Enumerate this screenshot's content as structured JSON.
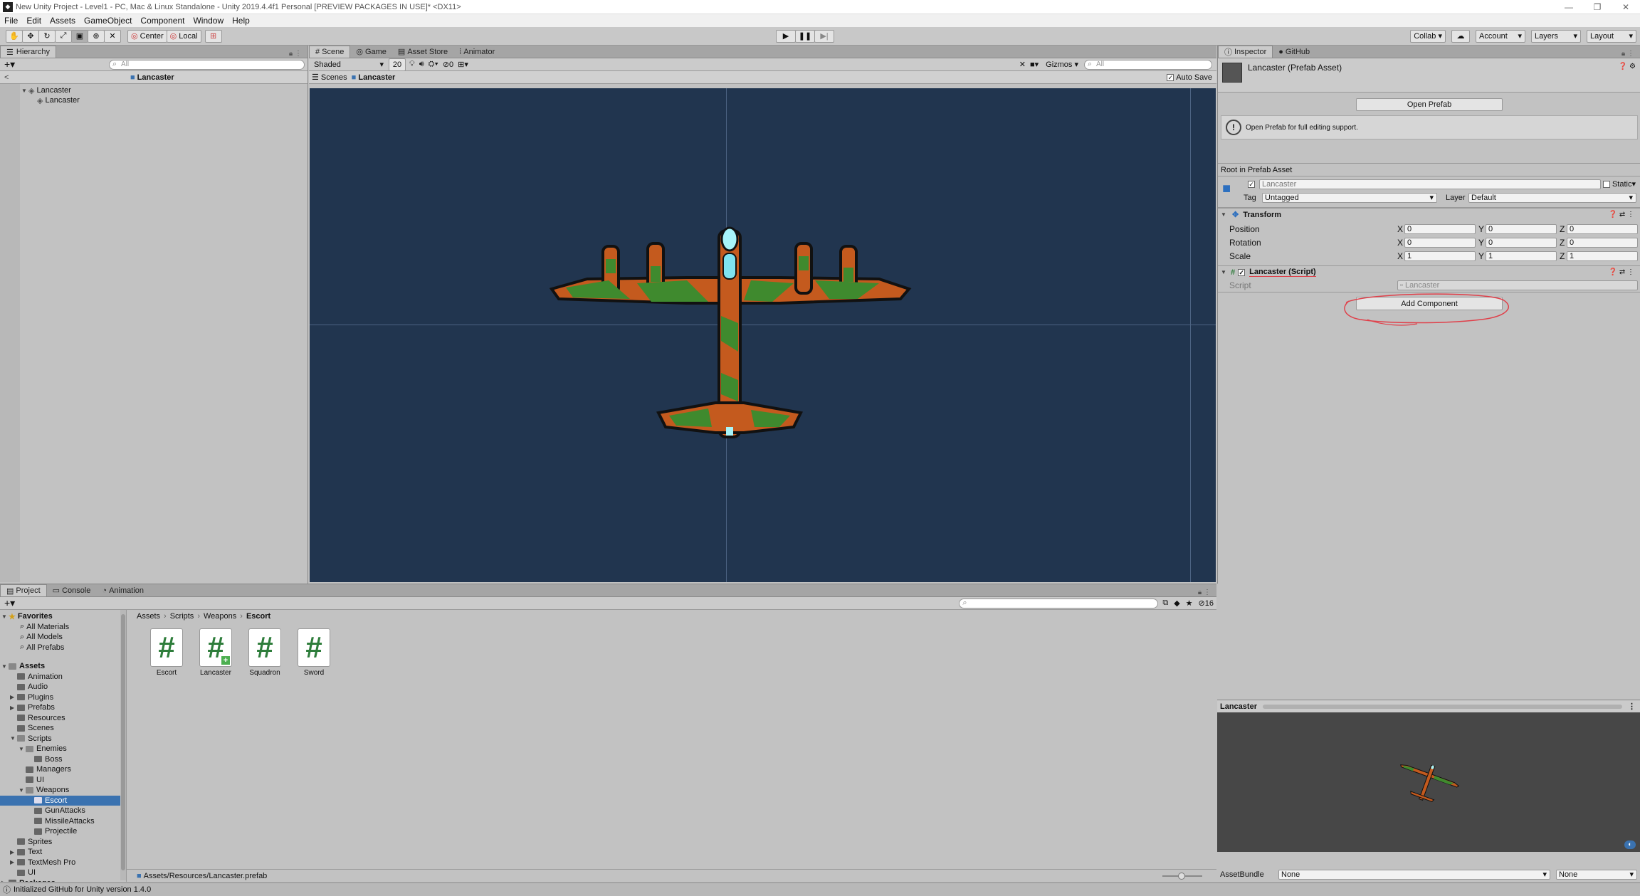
{
  "window": {
    "title": "New Unity Project - Level1 - PC, Mac & Linux Standalone - Unity 2019.4.4f1 Personal [PREVIEW PACKAGES IN USE]* <DX11>",
    "minimize": "—",
    "maximize": "❐",
    "close": "✕"
  },
  "menu": [
    "File",
    "Edit",
    "Assets",
    "GameObject",
    "Component",
    "Window",
    "Help"
  ],
  "toolbar": {
    "center": "Center",
    "local": "Local",
    "collab": "Collab",
    "account": "Account",
    "layers": "Layers",
    "layout": "Layout"
  },
  "hierarchy": {
    "tab": "Hierarchy",
    "search_placeholder": "All",
    "breadcrumb": "Lancaster",
    "items": [
      "Lancaster",
      "Lancaster"
    ]
  },
  "scene_tabs": [
    "Scene",
    "Game",
    "Asset Store",
    "Animator"
  ],
  "scene": {
    "shading": "Shaded",
    "dim": "20",
    "fx_count": "0",
    "gizmos": "Gizmos",
    "search_placeholder": "All",
    "breadcrumb_root": "Scenes",
    "breadcrumb_item": "Lancaster",
    "autosave": "Auto Save"
  },
  "inspector": {
    "tabs": [
      "Inspector",
      "GitHub"
    ],
    "title": "Lancaster (Prefab Asset)",
    "open_prefab": "Open Prefab",
    "info": "Open Prefab for full editing support.",
    "root": "Root in Prefab Asset",
    "name": "Lancaster",
    "static": "Static",
    "tag_label": "Tag",
    "tag_value": "Untagged",
    "layer_label": "Layer",
    "layer_value": "Default",
    "transform": {
      "title": "Transform",
      "rows": [
        {
          "label": "Position",
          "x": "0",
          "y": "0",
          "z": "0"
        },
        {
          "label": "Rotation",
          "x": "0",
          "y": "0",
          "z": "0"
        },
        {
          "label": "Scale",
          "x": "1",
          "y": "1",
          "z": "1"
        }
      ]
    },
    "script_comp": {
      "title": "Lancaster (Script)",
      "script_label": "Script",
      "script_value": "Lancaster"
    },
    "add_component": "Add Component",
    "preview_title": "Lancaster",
    "assetbundle_label": "AssetBundle",
    "assetbundle_value": "None",
    "assetbundle_variant": "None"
  },
  "project": {
    "tabs": [
      "Project",
      "Console",
      "Animation"
    ],
    "count": "16",
    "breadcrumb": [
      "Assets",
      "Scripts",
      "Weapons",
      "Escort"
    ],
    "favorites_label": "Favorites",
    "favorites": [
      "All Materials",
      "All Models",
      "All Prefabs"
    ],
    "assets_label": "Assets",
    "tree": [
      {
        "label": "Animation",
        "depth": 1
      },
      {
        "label": "Audio",
        "depth": 1
      },
      {
        "label": "Plugins",
        "depth": 1,
        "arrow": "▶"
      },
      {
        "label": "Prefabs",
        "depth": 1,
        "arrow": "▶"
      },
      {
        "label": "Resources",
        "depth": 1
      },
      {
        "label": "Scenes",
        "depth": 1
      },
      {
        "label": "Scripts",
        "depth": 1,
        "arrow": "▼"
      },
      {
        "label": "Enemies",
        "depth": 2,
        "arrow": "▼"
      },
      {
        "label": "Boss",
        "depth": 3
      },
      {
        "label": "Managers",
        "depth": 2
      },
      {
        "label": "UI",
        "depth": 2
      },
      {
        "label": "Weapons",
        "depth": 2,
        "arrow": "▼"
      },
      {
        "label": "Escort",
        "depth": 3,
        "selected": true
      },
      {
        "label": "GunAttacks",
        "depth": 3
      },
      {
        "label": "MissileAttacks",
        "depth": 3
      },
      {
        "label": "Projectile",
        "depth": 3
      },
      {
        "label": "Sprites",
        "depth": 1
      },
      {
        "label": "Text",
        "depth": 1,
        "arrow": "▶"
      },
      {
        "label": "TextMesh Pro",
        "depth": 1,
        "arrow": "▶"
      },
      {
        "label": "UI",
        "depth": 1
      },
      {
        "label": "Packages",
        "depth": 0,
        "arrow": "▶"
      }
    ],
    "files": [
      "Escort",
      "Lancaster",
      "Squadron",
      "Sword"
    ],
    "path": "Assets/Resources/Lancaster.prefab"
  },
  "status": "Initialized GitHub for Unity version 1.4.0",
  "colors": {
    "scene_bg": "#21354f",
    "selection": "#3a72b0",
    "annotation": "#e0404a"
  }
}
